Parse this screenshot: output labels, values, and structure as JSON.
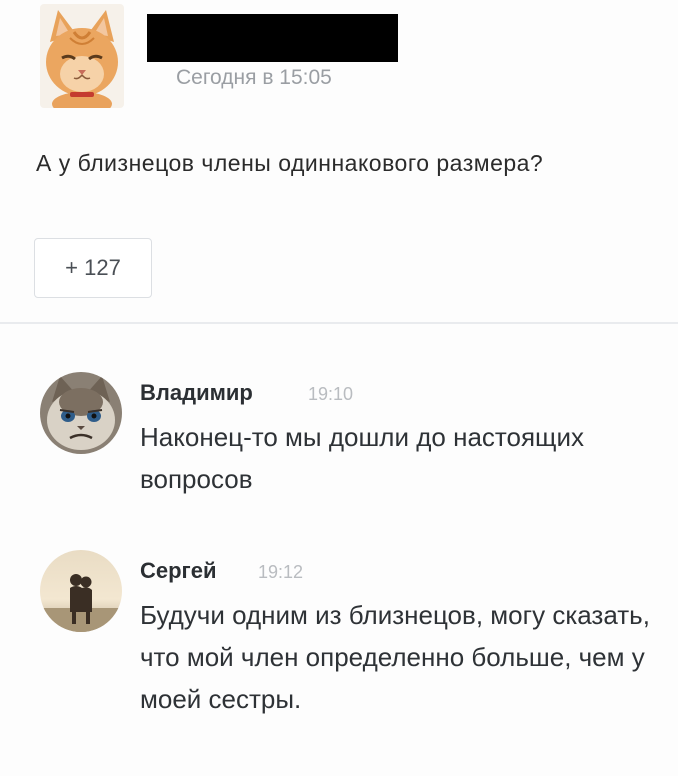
{
  "post": {
    "time": "Сегодня в 15:05",
    "text": "А у близнецов члены одиннакового размера?",
    "likes": "+ 127"
  },
  "comments": [
    {
      "author": "Владимир",
      "time": "19:10",
      "text": "Наконец-то мы дошли до настоящих вопросов"
    },
    {
      "author": "Сергей",
      "time": "19:12",
      "text": "Будучи одним из близнецов, могу сказать, что мой член определенно больше, чем у моей сестры."
    }
  ],
  "colors": {
    "redaction": "#000000",
    "muted_text": "#9a9ea3",
    "divider": "#e9ebee"
  },
  "icons": {
    "post_avatar": "orange-cat-avatar-icon",
    "comment_1_avatar": "grumpy-cat-avatar-icon",
    "comment_2_avatar": "couple-silhouette-avatar-icon"
  }
}
